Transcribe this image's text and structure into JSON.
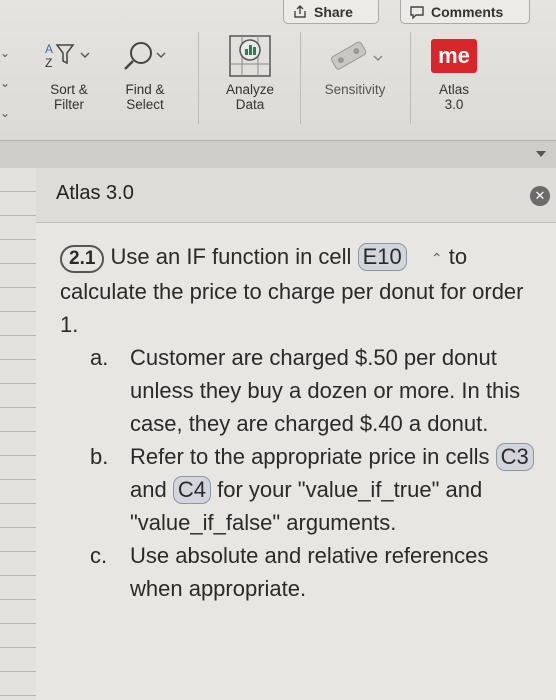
{
  "ribbon": {
    "share_label": "Share",
    "comments_label": "Comments",
    "tools": {
      "sort": "Sort &\nFilter",
      "sort_line1": "Sort &",
      "sort_line2": "Filter",
      "find_line1": "Find &",
      "find_line2": "Select",
      "analyze_line1": "Analyze",
      "analyze_line2": "Data",
      "sensitivity": "Sensitivity",
      "atlas_line1": "Atlas",
      "atlas_line2": "3.0",
      "atlas_logo": "me"
    }
  },
  "panel": {
    "title": "Atlas 3.0",
    "question": {
      "number": "2.1",
      "intro_before": "Use an IF function in cell",
      "cell": "E10",
      "intro_after": "to calculate the price to charge per donut for order 1.",
      "items": [
        {
          "marker": "a.",
          "text": "Customer are charged $.50 per donut unless they buy a dozen or more. In this case, they are charged $.40 a donut."
        },
        {
          "marker": "b.",
          "text_before": "Refer to the appropriate price in cells",
          "cell1": "C3",
          "text_mid": "and",
          "cell2": "C4",
          "text_after": "for your \"value_if_true\" and \"value_if_false\" arguments."
        },
        {
          "marker": "c.",
          "text": "Use absolute and relative references when appropriate."
        }
      ]
    }
  },
  "colors": {
    "atlas_logo_bg": "#d9262b",
    "cell_ref_bg": "#d2d6dc"
  }
}
